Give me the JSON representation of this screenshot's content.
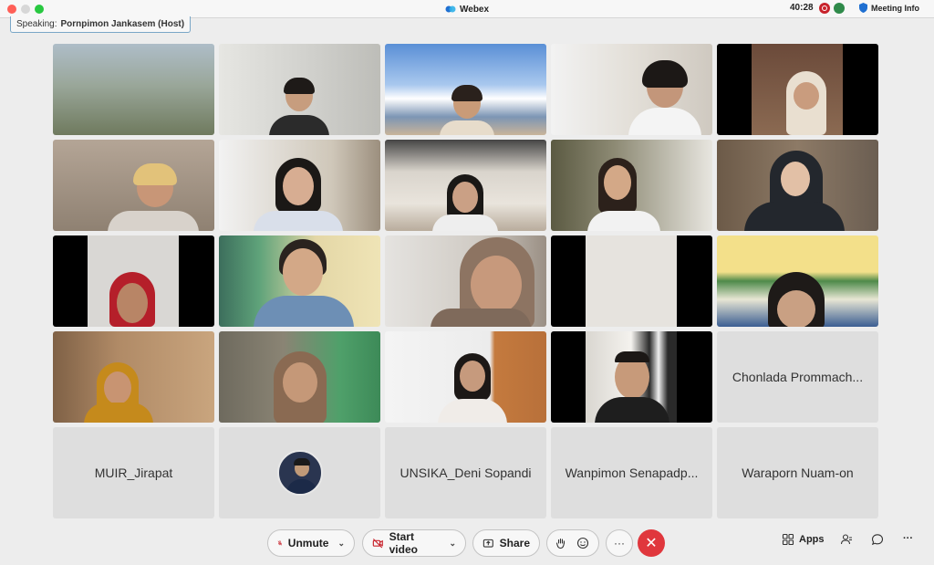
{
  "titlebar": {
    "app_name": "Webex",
    "elapsed_time": "40:28",
    "meeting_info_label": "Meeting Info"
  },
  "speaking": {
    "prefix": "Speaking:",
    "name": "Pornpimon Jankasem (Host)"
  },
  "name_tiles": {
    "r4c5": "Chonlada Prommach...",
    "r5c1": "MUIR_Jirapat",
    "r5c3": "UNSIKA_Deni Sopandi",
    "r5c4": "Wanpimon Senapadp...",
    "r5c5": "Waraporn Nuam-on"
  },
  "toolbar": {
    "unmute_label": "Unmute",
    "start_video_label": "Start video",
    "share_label": "Share",
    "more_label": "···",
    "apps_label": "Apps",
    "overflow_label": "···"
  }
}
